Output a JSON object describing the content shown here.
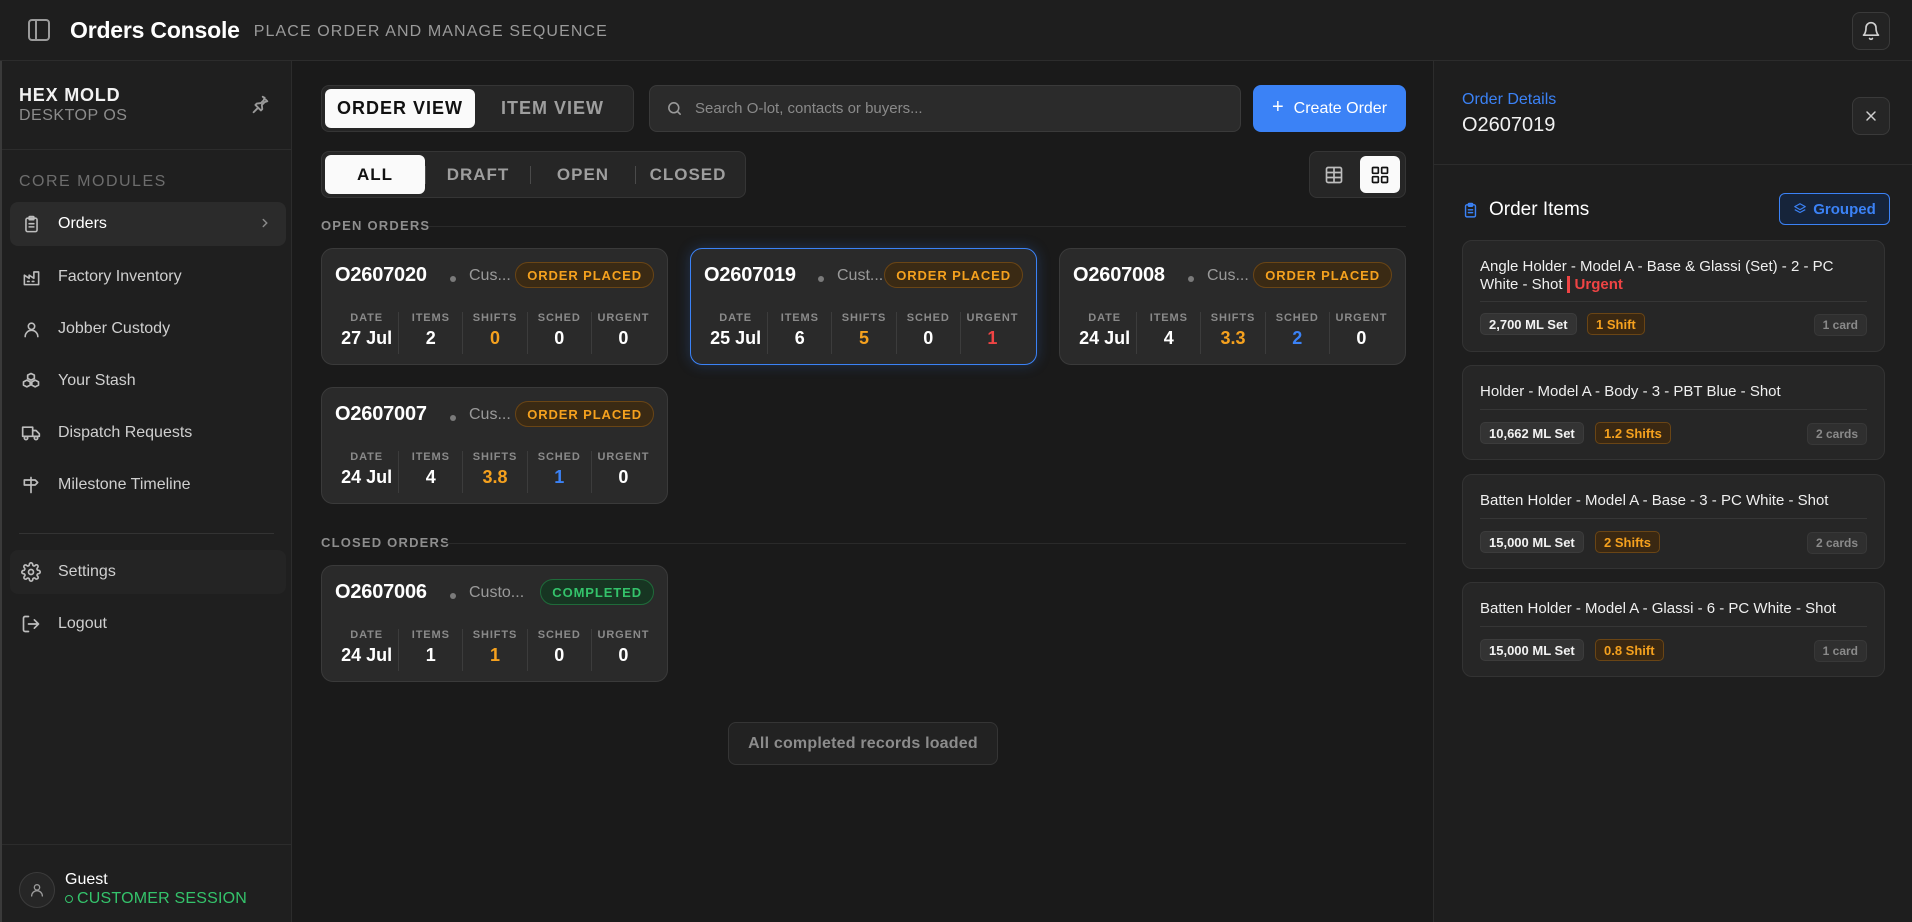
{
  "header": {
    "title": "Orders Console",
    "subtitle": "PLACE ORDER AND MANAGE SEQUENCE"
  },
  "sidebar": {
    "brand": "HEX MOLD",
    "brand_sub": "DESKTOP OS",
    "section": "CORE MODULES",
    "items": [
      {
        "label": "Orders",
        "icon": "clipboard-icon"
      },
      {
        "label": "Factory Inventory",
        "icon": "factory-icon"
      },
      {
        "label": "Jobber Custody",
        "icon": "user-icon"
      },
      {
        "label": "Your Stash",
        "icon": "boxes-icon"
      },
      {
        "label": "Dispatch Requests",
        "icon": "truck-icon"
      },
      {
        "label": "Milestone Timeline",
        "icon": "signpost-icon"
      }
    ],
    "settings": "Settings",
    "logout": "Logout",
    "user_name": "Guest",
    "user_session": "CUSTOMER SESSION"
  },
  "toolbar": {
    "view_tabs": [
      "ORDER VIEW",
      "ITEM VIEW"
    ],
    "search_placeholder": "Search O-lot, contacts or buyers...",
    "create_label": "Create Order",
    "filters": [
      "ALL",
      "DRAFT",
      "OPEN",
      "CLOSED"
    ]
  },
  "open_label": "OPEN ORDERS",
  "closed_label": "CLOSED ORDERS",
  "stat_keys": [
    "DATE",
    "ITEMS",
    "SHIFTS",
    "SCHED",
    "URGENT"
  ],
  "open_orders": [
    {
      "id": "O2607020",
      "customer": "Cus...",
      "status": "ORDER PLACED",
      "date": "27 Jul",
      "items": "2",
      "shifts": "0",
      "sched": "0",
      "urgent": "0"
    },
    {
      "id": "O2607019",
      "customer": "Cust...",
      "status": "ORDER PLACED",
      "date": "25 Jul",
      "items": "6",
      "shifts": "5",
      "sched": "0",
      "urgent": "1"
    },
    {
      "id": "O2607008",
      "customer": "Cus...",
      "status": "ORDER PLACED",
      "date": "24 Jul",
      "items": "4",
      "shifts": "3.3",
      "sched": "2",
      "urgent": "0"
    },
    {
      "id": "O2607007",
      "customer": "Cus...",
      "status": "ORDER PLACED",
      "date": "24 Jul",
      "items": "4",
      "shifts": "3.8",
      "sched": "1",
      "urgent": "0"
    }
  ],
  "closed_orders": [
    {
      "id": "O2607006",
      "customer": "Custo...",
      "status": "COMPLETED",
      "date": "24 Jul",
      "items": "1",
      "shifts": "1",
      "sched": "0",
      "urgent": "0"
    }
  ],
  "loaded_text": "All completed records loaded",
  "details": {
    "label": "Order Details",
    "order_id": "O2607019",
    "items_title": "Order Items",
    "grouped": "Grouped",
    "items": [
      {
        "title": "Angle Holder - Model A - Base & Glassi (Set) - 2 - PC White - Shot",
        "urgent": "Urgent",
        "qty": "2,700 ML Set",
        "shift": "1 Shift",
        "cards": "1 card"
      },
      {
        "title": "Holder - Model A - Body - 3 - PBT Blue - Shot",
        "qty": "10,662 ML Set",
        "shift": "1.2 Shifts",
        "cards": "2 cards"
      },
      {
        "title": "Batten Holder - Model A - Base - 3 - PC White - Shot",
        "qty": "15,000 ML Set",
        "shift": "2 Shifts",
        "cards": "2 cards"
      },
      {
        "title": "Batten Holder - Model A - Glassi - 6 - PC White - Shot",
        "qty": "15,000 ML Set",
        "shift": "0.8 Shift",
        "cards": "1 card"
      }
    ]
  },
  "colors": {
    "accent": "#3b82f6",
    "orange": "#f5a11e",
    "green": "#34c36b",
    "red": "#ef4444"
  }
}
